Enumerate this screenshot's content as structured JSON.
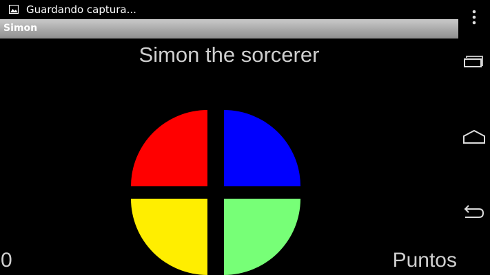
{
  "status_bar": {
    "notification_text": "Guardando captura...",
    "notification_icon": "image-icon"
  },
  "action_bar": {
    "title": "Simon"
  },
  "game": {
    "title": "Simon the sorcerer",
    "buttons": [
      {
        "name": "red",
        "color": "#ff0000"
      },
      {
        "name": "blue",
        "color": "#0000ff"
      },
      {
        "name": "yellow",
        "color": "#ffee00"
      },
      {
        "name": "green",
        "color": "#77ff77"
      }
    ],
    "score": "0",
    "score_label": "Puntos"
  },
  "nav": {
    "icons": [
      "overflow-menu-icon",
      "recent-apps-icon",
      "home-icon",
      "back-icon"
    ]
  }
}
